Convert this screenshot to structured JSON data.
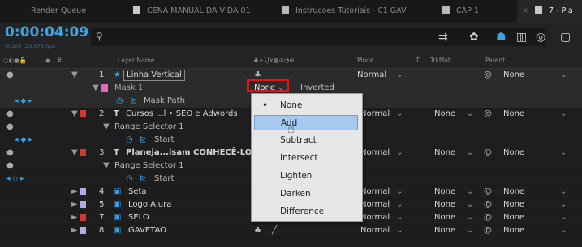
{
  "tabs": [
    {
      "label": "Render Queue",
      "color": null
    },
    {
      "label": "CENA MANUAL DA VIDA 01",
      "color": "#c9c9c9"
    },
    {
      "label": "Instrucoes Tutoriais - 01 GAV",
      "color": "#b8b8b8"
    },
    {
      "label": "CAP 1",
      "color": "#b8b8b8"
    },
    {
      "label": "7 - Pla",
      "color": "#c9c9c9",
      "active": true
    }
  ],
  "timecode": "0:00:04:09",
  "fps": "00105 (23.976 fps)",
  "search": {
    "placeholder": ""
  },
  "columns": {
    "layer_name": "Layer Name",
    "mode": "Mode",
    "t": "T",
    "trkmat": "TrkMat",
    "parent": "Parent"
  },
  "rows": [
    {
      "num": "1",
      "name": "Linha Vertical",
      "label_color": "#c9c9c9",
      "mode": "Normal",
      "parent": "None"
    },
    {
      "name": "Mask 1",
      "label_color": "#e066c0",
      "mask_mode": "None",
      "inverted": "Inverted"
    },
    {
      "name": "Mask Path"
    },
    {
      "num": "2",
      "name": "Cursos ...l  • SEO e Adwords",
      "label_color": "#d23a2e",
      "mode": "Normal",
      "trkmat": "None",
      "parent": "None"
    },
    {
      "name": "Range Selector 1"
    },
    {
      "name": "Start"
    },
    {
      "num": "3",
      "name": "Planeja...isam CONHECÊ-LO!",
      "label_color": "#d23a2e",
      "mode": "Normal",
      "trkmat": "None",
      "parent": "None"
    },
    {
      "name": "Range Selector 1"
    },
    {
      "name": "Start"
    },
    {
      "num": "4",
      "name": "Seta",
      "label_color": "#b8a8e8",
      "mode": "Normal",
      "trkmat": "None",
      "parent": "None"
    },
    {
      "num": "5",
      "name": "Logo Alura",
      "label_color": "#b8a8e8",
      "mode": "Normal",
      "trkmat": "None",
      "parent": "None"
    },
    {
      "num": "7",
      "name": "SELO",
      "label_color": "#d23a2e",
      "mode": "Normal",
      "trkmat": "None",
      "parent": "None"
    },
    {
      "num": "8",
      "name": "GAVETAO",
      "label_color": "#b8a8e8",
      "mode": "Normal",
      "trkmat": "None",
      "parent": "None"
    }
  ],
  "mask_mode_menu": {
    "selected": "None",
    "highlighted": "Add",
    "items": [
      "None",
      "Add",
      "Subtract",
      "Intersect",
      "Lighten",
      "Darken",
      "Difference"
    ]
  }
}
